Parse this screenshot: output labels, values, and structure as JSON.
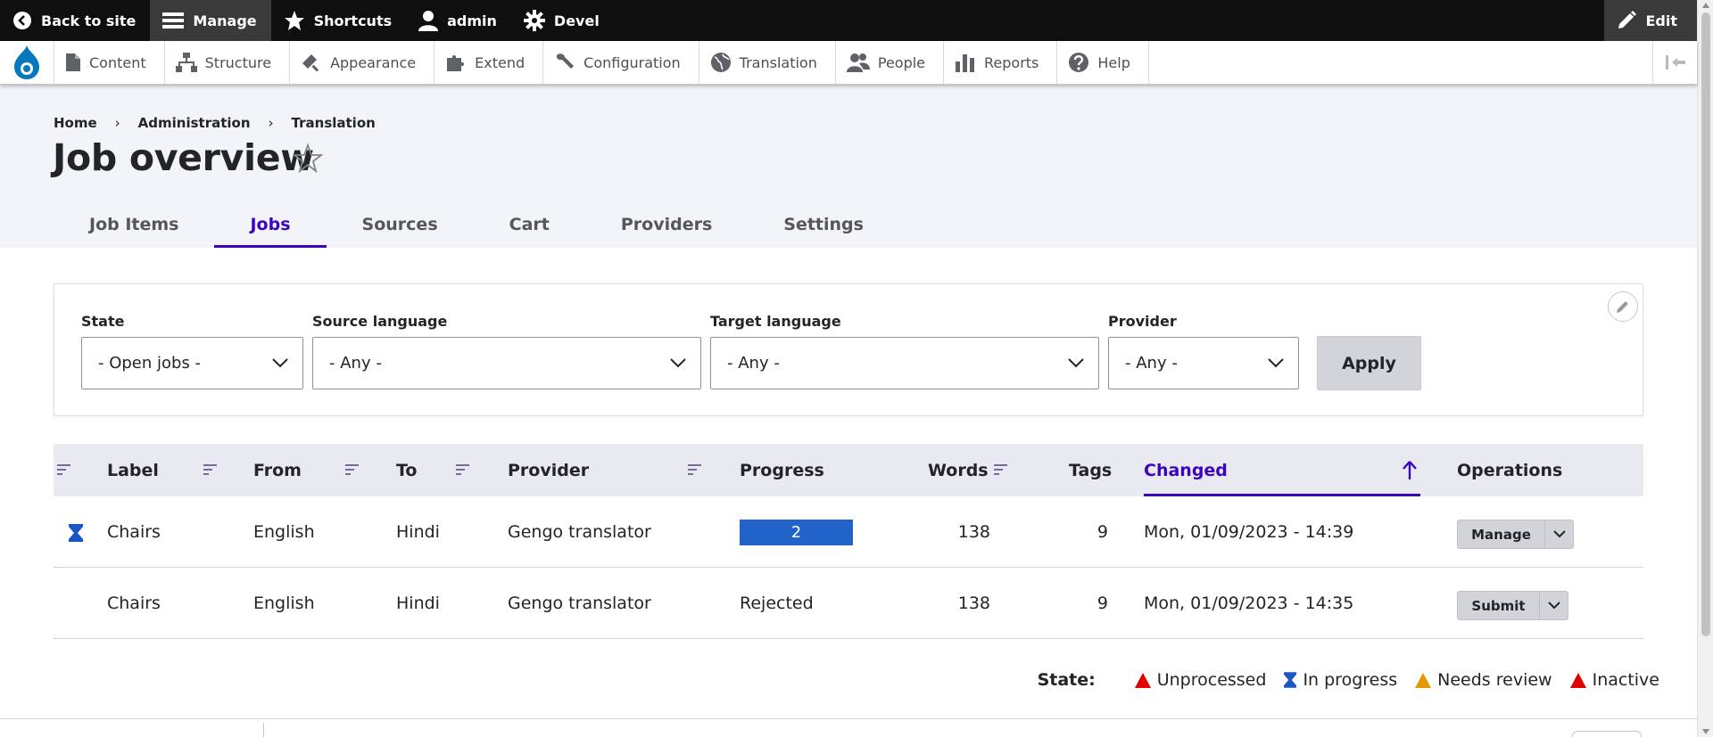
{
  "toolbar": {
    "back": "Back to site",
    "manage": "Manage",
    "shortcuts": "Shortcuts",
    "user": "admin",
    "devel": "Devel",
    "edit": "Edit"
  },
  "tray": {
    "items": [
      "Content",
      "Structure",
      "Appearance",
      "Extend",
      "Configuration",
      "Translation",
      "People",
      "Reports",
      "Help"
    ]
  },
  "breadcrumb": [
    "Home",
    "Administration",
    "Translation"
  ],
  "page_title": "Job overview",
  "tabs": [
    "Job Items",
    "Jobs",
    "Sources",
    "Cart",
    "Providers",
    "Settings"
  ],
  "active_tab": "Jobs",
  "filters": {
    "state": {
      "label": "State",
      "value": "- Open jobs -"
    },
    "source_language": {
      "label": "Source language",
      "value": "- Any -"
    },
    "target_language": {
      "label": "Target language",
      "value": "- Any -"
    },
    "provider": {
      "label": "Provider",
      "value": "- Any -"
    },
    "apply": "Apply"
  },
  "table": {
    "headers": {
      "label": "Label",
      "from": "From",
      "to": "To",
      "provider": "Provider",
      "progress": "Progress",
      "words": "Words",
      "tags": "Tags",
      "changed": "Changed",
      "operations": "Operations"
    },
    "sorted_by": "Changed",
    "sort_direction": "ascending",
    "rows": [
      {
        "state_icon": "hourglass-icon",
        "label": "Chairs",
        "from": "English",
        "to": "Hindi",
        "provider": "Gengo translator",
        "progress": "2",
        "progress_fraction": 1.0,
        "words": "138",
        "tags": "9",
        "changed": "Mon, 01/09/2023 - 14:39",
        "operation": "Manage"
      },
      {
        "state_icon": "",
        "label": "Chairs",
        "from": "English",
        "to": "Hindi",
        "provider": "Gengo translator",
        "progress": "Rejected",
        "words": "138",
        "tags": "9",
        "changed": "Mon, 01/09/2023 - 14:35",
        "operation": "Submit"
      }
    ]
  },
  "legend": {
    "title": "State:",
    "items": [
      {
        "label": "Unprocessed",
        "icon": "red-triangle-icon",
        "color": "#e00000"
      },
      {
        "label": "In progress",
        "icon": "hourglass-icon",
        "color": "#1a57c4"
      },
      {
        "label": "Needs review",
        "icon": "orange-triangle-icon",
        "color": "#e59900"
      },
      {
        "label": "Inactive",
        "icon": "red-triangle-icon",
        "color": "#e00000"
      }
    ]
  },
  "colors": {
    "accent": "#3b05bd",
    "progress_bar": "#2163c8",
    "toolbar": "#0f0f0f",
    "header_bg": "#f3f4f9",
    "drupal_blue": "#0678be"
  }
}
